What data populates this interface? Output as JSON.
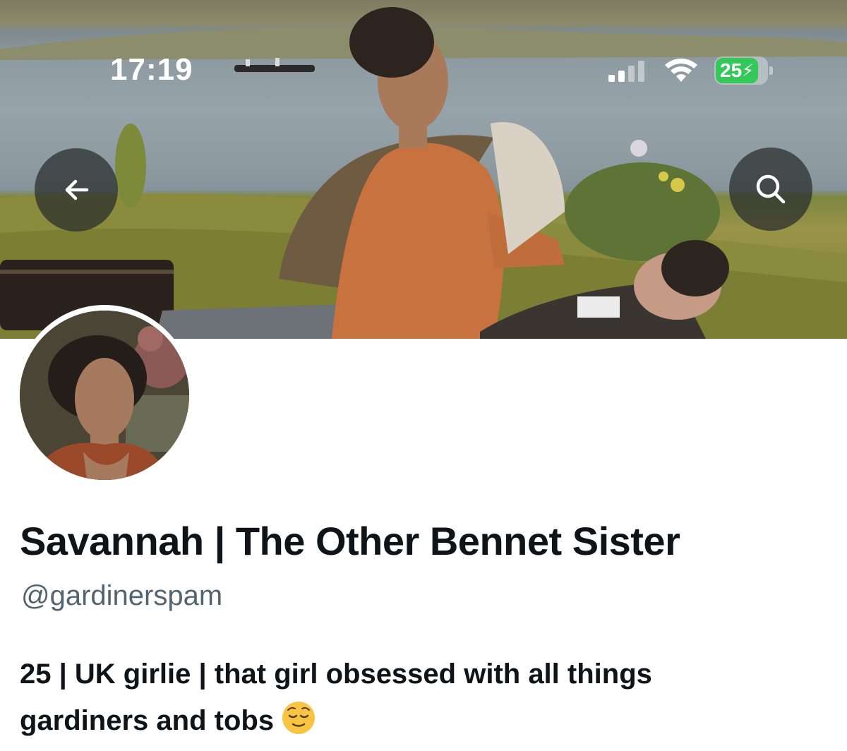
{
  "status_bar": {
    "time": "17:19",
    "battery_level": "25"
  },
  "header": {
    "back_icon": "arrow-left-icon",
    "search_icon": "search-icon"
  },
  "profile": {
    "display_name": "Savannah | The Other Bennet Sister",
    "handle": "@gardinerspam",
    "bio_line_1": "25 | UK girlie | that girl obsessed with all things",
    "bio_line_2": "gardiners and tobs",
    "bio_emoji": "relieved-face-emoji"
  },
  "colors": {
    "text_primary": "#0f1419",
    "text_secondary": "#536471",
    "battery_green": "#34c759",
    "overlay_button": "#282c2c"
  }
}
